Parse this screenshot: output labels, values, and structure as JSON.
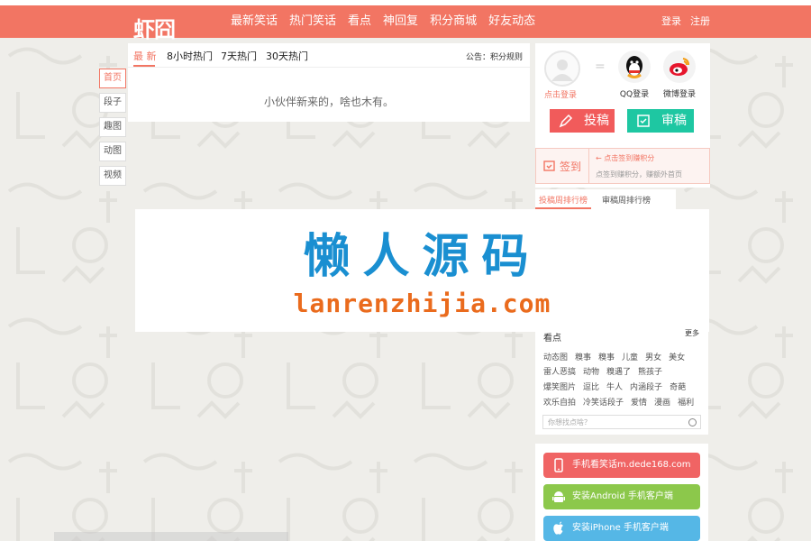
{
  "brand": {
    "logo": "虾囧"
  },
  "header": {
    "nav": [
      "最新笑话",
      "热门笑话",
      "看点",
      "神回复",
      "积分商城",
      "好友动态"
    ],
    "login": "登录",
    "register": "注册"
  },
  "leftnav": [
    "首页",
    "段子",
    "趣图",
    "动图",
    "视频"
  ],
  "feed": {
    "tabs": [
      "最 新",
      "8小时热门",
      "7天热门",
      "30天热门"
    ],
    "notice": "公告：积分规则",
    "empty_message": "小伙伴新来的，啥也木有。"
  },
  "sidebar": {
    "login_link": "点击登录",
    "qq_login": "QQ登录",
    "weibo_login": "微博登录",
    "post_button": "投稿",
    "review_button": "审稿",
    "checkin": {
      "label": "签到",
      "tip": "点击签到赚积分",
      "desc": "点签到赚积分，赚额外首页"
    },
    "rank_tabs": [
      "投稿周排行榜",
      "审稿周排行榜"
    ],
    "tags_title": "看点",
    "tags_more": "更多",
    "tag_rows": [
      [
        "动态图",
        "糗事",
        "糗事",
        "儿童",
        "男女",
        "美女"
      ],
      [
        "雷人恶搞",
        "动物",
        "糗遇了",
        "熊孩子"
      ],
      [
        "爆笑图片",
        "逗比",
        "牛人",
        "内涵段子",
        "奇葩"
      ],
      [
        "欢乐自拍",
        "冷笑话段子",
        "爱情",
        "漫画",
        "福利"
      ]
    ],
    "search_placeholder": "你想找点啥？",
    "apps": [
      {
        "label": "手机看笑话m.dede168.com",
        "color": "#f06464"
      },
      {
        "label": "安装Android 手机客户端",
        "color": "#8cc84b"
      },
      {
        "label": "安装iPhone 手机客户端",
        "color": "#55b7e6"
      }
    ]
  },
  "ad": {
    "cn": "懒人源码",
    "en": "lanrenzhijia.com"
  },
  "colors": {
    "primary": "#f27563",
    "review": "#1ec7a2",
    "ad_blue": "#1a8fd1",
    "ad_orange": "#ea6b1d"
  }
}
